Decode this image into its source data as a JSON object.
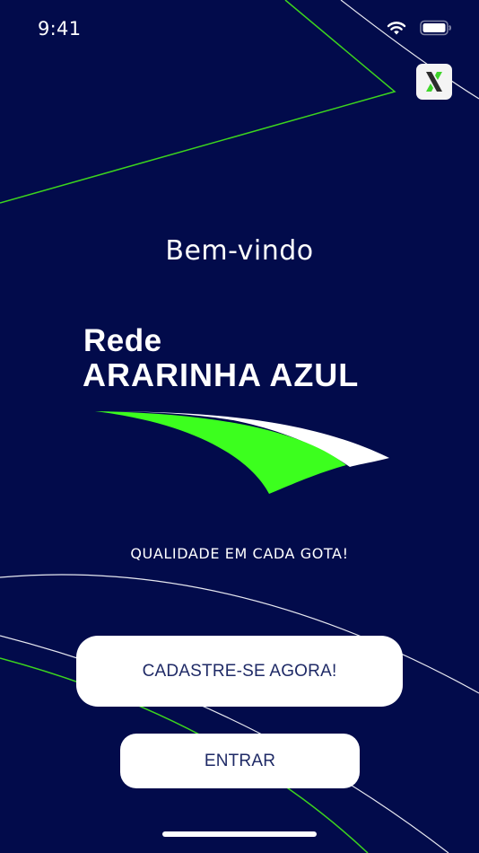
{
  "status_bar": {
    "time": "9:41",
    "icons": [
      "wifi-icon",
      "battery-icon"
    ]
  },
  "brand_badge": {
    "icon": "brand-x-icon"
  },
  "welcome": {
    "title": "Bem-vindo"
  },
  "logo": {
    "line1": "Rede",
    "line2": "ARARINHA AZUL",
    "swoosh_icon": "wing-swoosh-icon"
  },
  "slogan": "QUALIDADE EM CADA GOTA!",
  "actions": {
    "signup_label": "CADASTRE-SE AGORA!",
    "login_label": "ENTRAR"
  },
  "colors": {
    "background": "#020b4b",
    "accent_green": "#3cff1e",
    "button_text": "#1f2a66",
    "white": "#ffffff"
  }
}
